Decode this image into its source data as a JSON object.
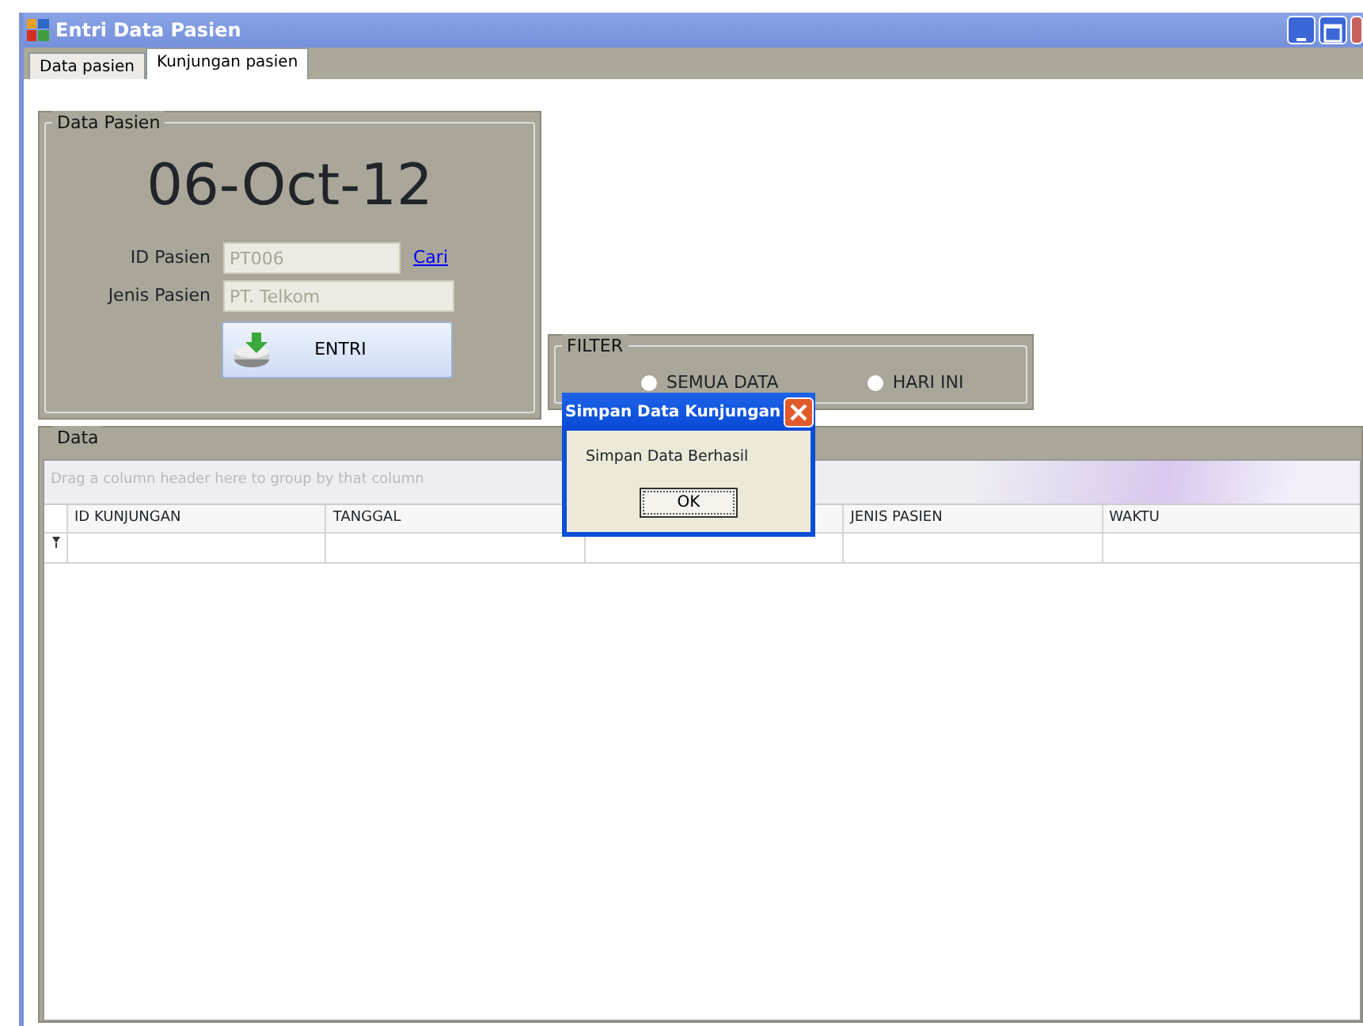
{
  "window": {
    "title": "Entri Data Pasien"
  },
  "tabs": [
    {
      "label": "Data pasien",
      "selected": false
    },
    {
      "label": "Kunjungan pasien",
      "selected": true
    }
  ],
  "patient_group": {
    "legend": "Data Pasien",
    "date": "06-Oct-12",
    "fields": [
      {
        "label": "ID Pasien",
        "value": "PT006",
        "link": "Cari"
      },
      {
        "label": "Jenis Pasien",
        "value": "PT. Telkom"
      }
    ],
    "button": "ENTRI"
  },
  "filter": {
    "legend": "FILTER",
    "options": [
      {
        "label": "SEMUA DATA",
        "selected": false
      },
      {
        "label": "HARI INI",
        "selected": false
      }
    ]
  },
  "data_group": {
    "legend": "Data",
    "group_hint": "Drag a column header here to group by that column",
    "columns": [
      {
        "label": "ID KUNJUNGAN"
      },
      {
        "label": "TANGGAL"
      },
      {
        "covered": true
      },
      {
        "label": "JENIS PASIEN"
      },
      {
        "label": "WAKTU"
      }
    ]
  },
  "dialog": {
    "title": "Simpan Data Kunjungan",
    "message": "Simpan Data Berhasil",
    "button": "OK"
  }
}
